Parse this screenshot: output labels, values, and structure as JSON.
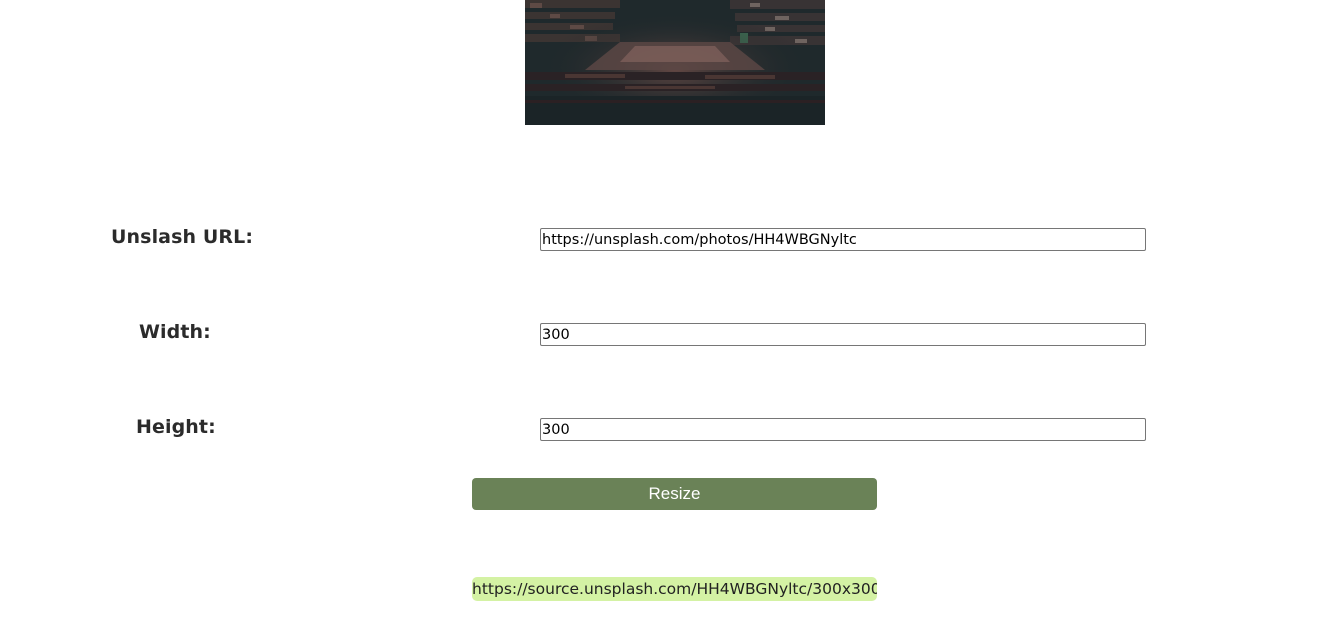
{
  "preview": {
    "image_alt": "bookshelves photo"
  },
  "form": {
    "url_label": "Unslash URL:",
    "url_value": "https://unsplash.com/photos/HH4WBGNyltc",
    "width_label": "Width:",
    "width_value": "300",
    "height_label": "Height:",
    "height_value": "300"
  },
  "actions": {
    "resize_label": "Resize"
  },
  "result": {
    "url": "https://source.unsplash.com/HH4WBGNyltc/300x300"
  },
  "colors": {
    "button_bg": "#6a8257",
    "result_bg": "#d4f2a4"
  }
}
